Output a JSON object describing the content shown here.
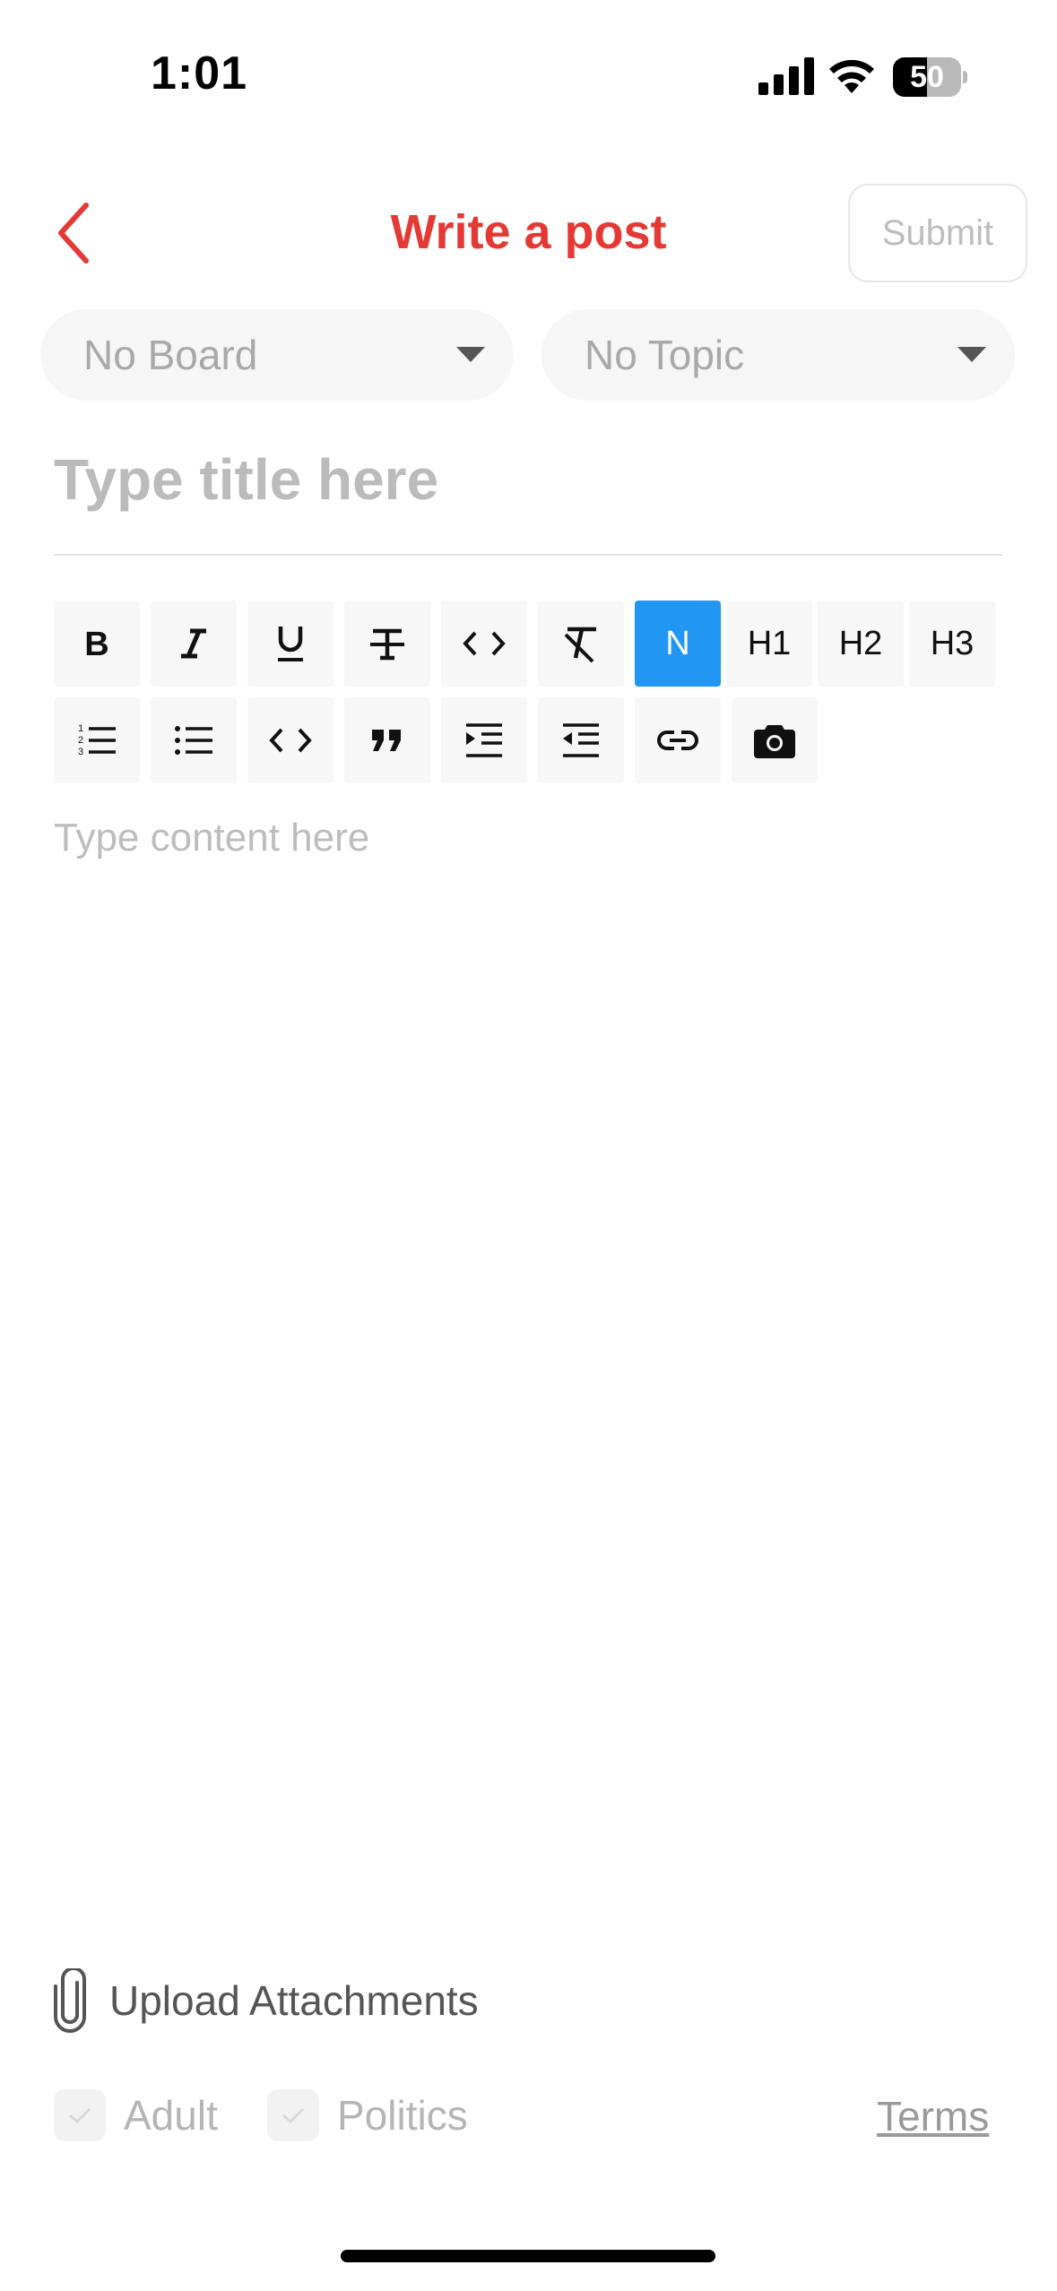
{
  "status_bar": {
    "time": "1:01",
    "battery_level": "50",
    "battery_fraction": 0.5
  },
  "header": {
    "title": "Write a post",
    "submit_label": "Submit"
  },
  "selectors": {
    "board": "No Board",
    "topic": "No Topic"
  },
  "title_field": {
    "placeholder": "Type title here",
    "value": ""
  },
  "toolbar": {
    "row1": [
      {
        "name": "bold",
        "icon": "bold-icon"
      },
      {
        "name": "italic",
        "icon": "italic-icon"
      },
      {
        "name": "underline",
        "icon": "underline-icon"
      },
      {
        "name": "strikethrough",
        "icon": "strikethrough-icon"
      },
      {
        "name": "inline-code",
        "icon": "code-icon"
      },
      {
        "name": "clear-format",
        "icon": "clear-format-icon"
      },
      {
        "name": "normal",
        "label": "N",
        "active": true
      },
      {
        "name": "heading-1",
        "label": "H1"
      },
      {
        "name": "heading-2",
        "label": "H2"
      },
      {
        "name": "heading-3",
        "label": "H3"
      }
    ],
    "row2": [
      {
        "name": "ordered-list",
        "icon": "ordered-list-icon"
      },
      {
        "name": "bullet-list",
        "icon": "bullet-list-icon"
      },
      {
        "name": "code-block",
        "icon": "code-icon"
      },
      {
        "name": "blockquote",
        "icon": "quote-icon"
      },
      {
        "name": "indent",
        "icon": "indent-icon"
      },
      {
        "name": "outdent",
        "icon": "outdent-icon"
      },
      {
        "name": "link",
        "icon": "link-icon"
      },
      {
        "name": "image",
        "icon": "camera-icon"
      }
    ],
    "active_color": "#2196f3"
  },
  "content_field": {
    "placeholder": "Type content here",
    "value": ""
  },
  "footer": {
    "upload_label": "Upload Attachments",
    "checkboxes": [
      {
        "label": "Adult",
        "checked": false
      },
      {
        "label": "Politics",
        "checked": false
      }
    ],
    "terms_label": "Terms"
  },
  "colors": {
    "accent": "#e53935",
    "selected": "#2196f3"
  }
}
